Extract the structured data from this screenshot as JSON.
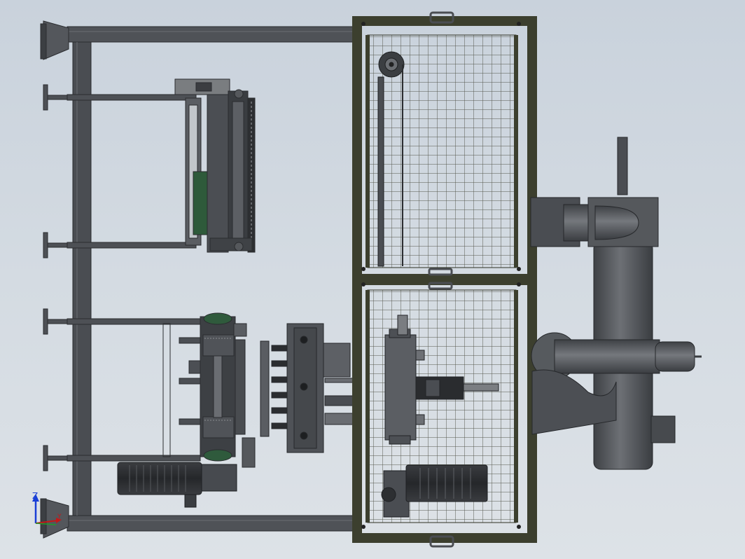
{
  "view": {
    "name": "cad-top-view",
    "triad": {
      "z_label": "Z",
      "y_label": "Y",
      "x_label": "X"
    }
  },
  "colors": {
    "background_top": "#c9d2dc",
    "background_bottom": "#dde2e7",
    "frame_steel": "#4a4d52",
    "enclosure_olive": "#3c3f2e",
    "mesh_wire": "#5b5d52",
    "motor_dark": "#2c2e31",
    "pipe_gray": "#56595d",
    "gear_green": "#2f5a3c",
    "triad_z": "#1a3fd6",
    "triad_y": "#c41818",
    "triad_x": "#1f9d2a"
  },
  "components": [
    "base-frame",
    "leveling-foot",
    "upper-roller-unit",
    "lower-drive-unit",
    "press-plate",
    "safety-enclosure",
    "enclosure-handle",
    "drive-motor",
    "pipe-elbow-upper",
    "pipe-elbow-lower",
    "vertical-duct",
    "support-bracket"
  ]
}
